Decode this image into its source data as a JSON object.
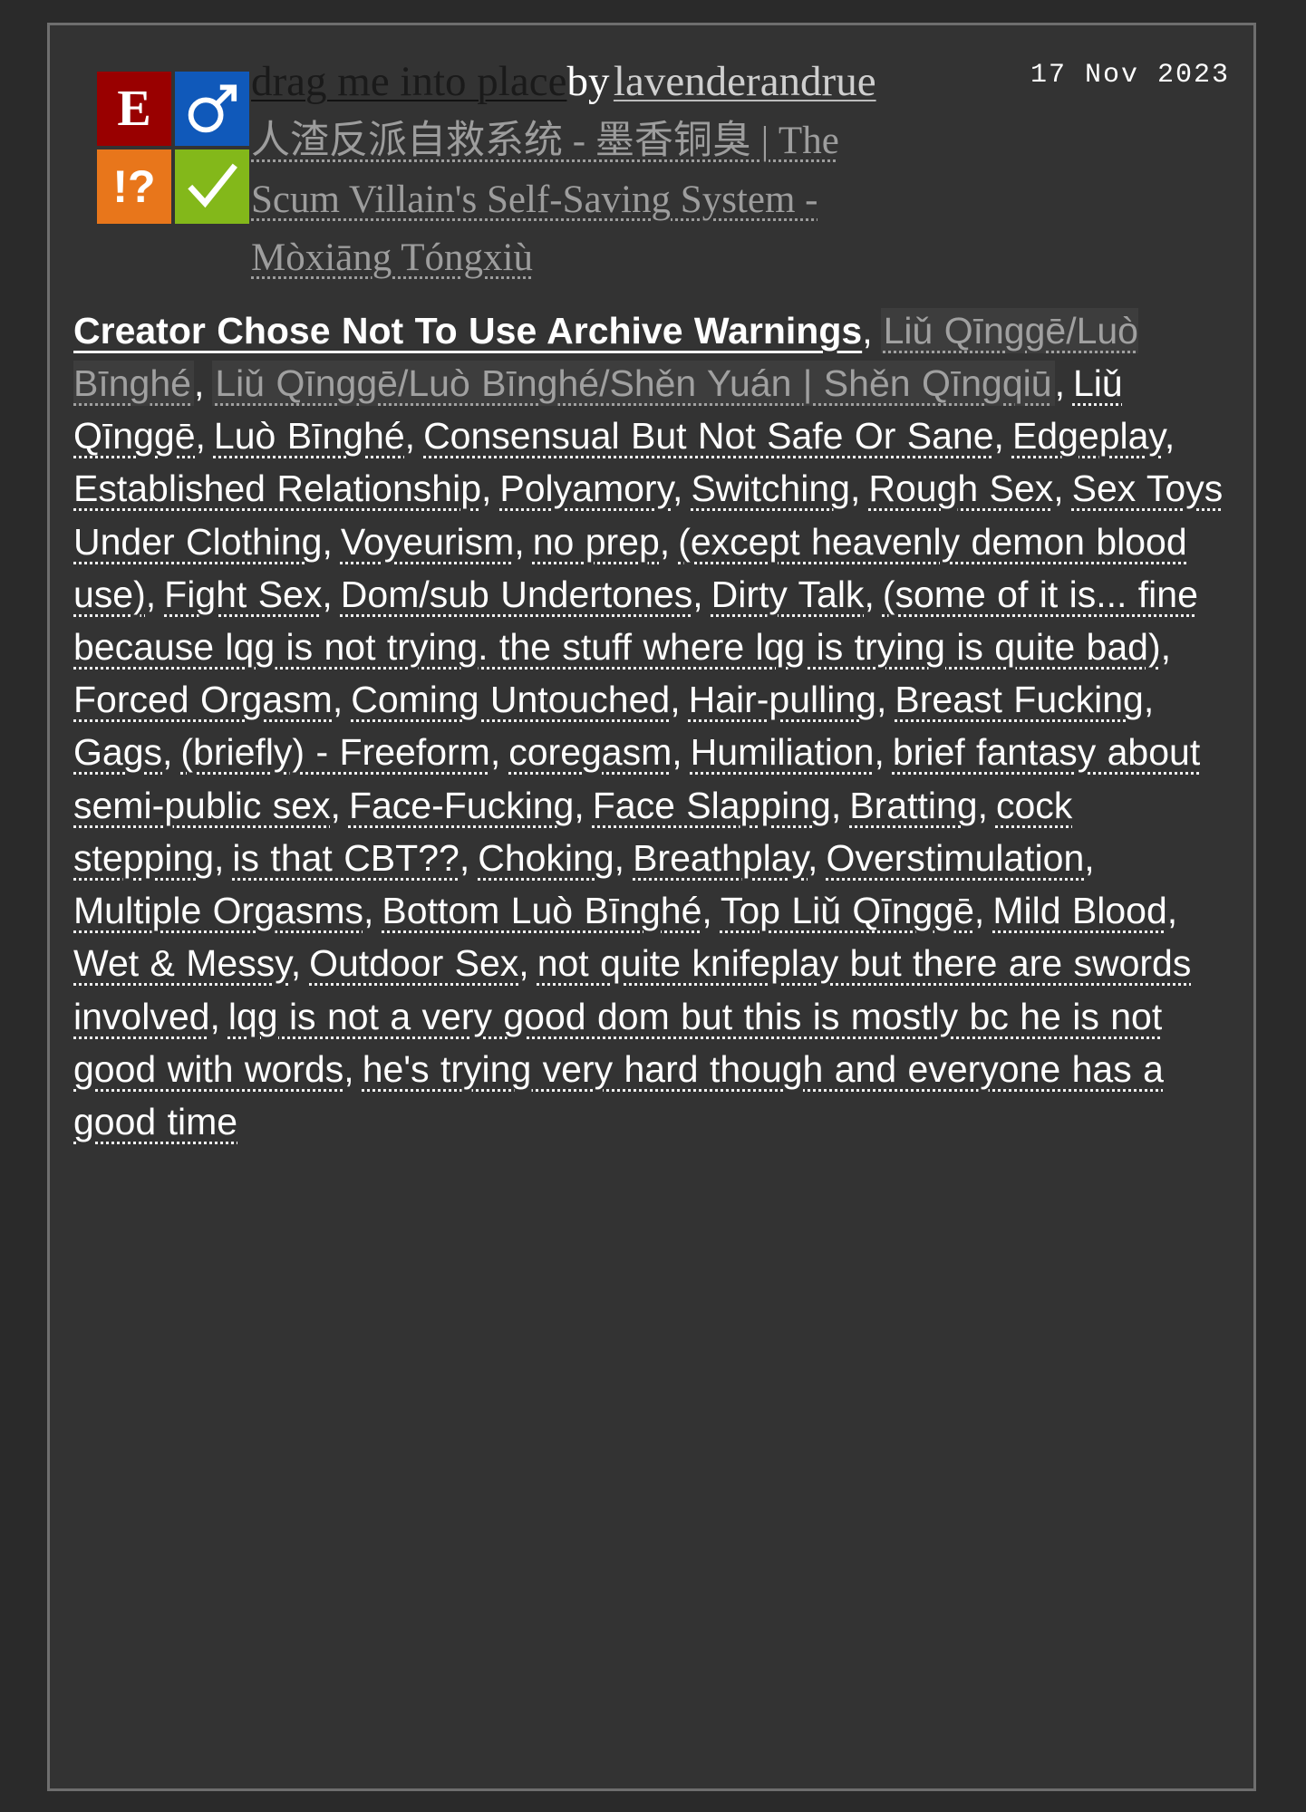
{
  "required_tags": [
    {
      "name": "rating-explicit",
      "glyph": "E",
      "label": "Explicit",
      "color": "#990000"
    },
    {
      "name": "category-male-male",
      "glyph": "♂",
      "label": "M/M",
      "color": "#1059ba"
    },
    {
      "name": "warning-choosenotto",
      "glyph": "!?",
      "label": "Choose Not To Use Archive Warnings",
      "color": "#e8761b"
    },
    {
      "name": "complete-yes",
      "glyph": "✓",
      "label": "Complete Work",
      "color": "#83b81a"
    }
  ],
  "header": {
    "title": "drag me into place",
    "by": "by",
    "author": "lavenderandrue",
    "date": "17 Nov 2023"
  },
  "fandoms": [
    "人渣反派自救系统 - 墨香铜臭 | The Scum Villain's Self-Saving System - Mòxiāng Tóngxiù"
  ],
  "tags": [
    {
      "text": "Creator Chose Not To Use Archive Warnings",
      "type": "warning"
    },
    {
      "text": "Liǔ Qīnggē/Luò Bīnghé",
      "type": "relationship"
    },
    {
      "text": "Liǔ Qīnggē/Luò Bīnghé/Shěn Yuán | Shěn Qīngqiū",
      "type": "relationship"
    },
    {
      "text": "Liǔ Qīnggē",
      "type": "character"
    },
    {
      "text": "Luò Bīnghé",
      "type": "character"
    },
    {
      "text": "Consensual But Not Safe Or Sane",
      "type": "freeform"
    },
    {
      "text": "Edgeplay",
      "type": "freeform"
    },
    {
      "text": "Established Relationship",
      "type": "freeform"
    },
    {
      "text": "Polyamory",
      "type": "freeform"
    },
    {
      "text": "Switching",
      "type": "freeform"
    },
    {
      "text": "Rough Sex",
      "type": "freeform"
    },
    {
      "text": "Sex Toys Under Clothing",
      "type": "freeform"
    },
    {
      "text": "Voyeurism",
      "type": "freeform"
    },
    {
      "text": "no prep",
      "type": "freeform"
    },
    {
      "text": "(except heavenly demon blood use)",
      "type": "freeform"
    },
    {
      "text": "Fight Sex",
      "type": "freeform"
    },
    {
      "text": "Dom/sub Undertones",
      "type": "freeform"
    },
    {
      "text": "Dirty Talk",
      "type": "freeform"
    },
    {
      "text": "(some of it is... fine because lqg is not trying. the stuff where lqg is trying is quite bad)",
      "type": "freeform"
    },
    {
      "text": "Forced Orgasm",
      "type": "freeform"
    },
    {
      "text": "Coming Untouched",
      "type": "freeform"
    },
    {
      "text": "Hair-pulling",
      "type": "freeform"
    },
    {
      "text": "Breast Fucking",
      "type": "freeform"
    },
    {
      "text": "Gags",
      "type": "freeform"
    },
    {
      "text": "(briefly) - Freeform",
      "type": "freeform"
    },
    {
      "text": "coregasm",
      "type": "freeform"
    },
    {
      "text": "Humiliation",
      "type": "freeform"
    },
    {
      "text": "brief fantasy about semi-public sex",
      "type": "freeform"
    },
    {
      "text": "Face-Fucking",
      "type": "freeform"
    },
    {
      "text": "Face Slapping",
      "type": "freeform"
    },
    {
      "text": "Bratting",
      "type": "freeform"
    },
    {
      "text": "cock stepping",
      "type": "freeform"
    },
    {
      "text": "is that CBT??",
      "type": "freeform"
    },
    {
      "text": "Choking",
      "type": "freeform"
    },
    {
      "text": "Breathplay",
      "type": "freeform"
    },
    {
      "text": "Overstimulation",
      "type": "freeform"
    },
    {
      "text": "Multiple Orgasms",
      "type": "freeform"
    },
    {
      "text": "Bottom Luò Bīnghé",
      "type": "freeform"
    },
    {
      "text": "Top Liǔ Qīnggē",
      "type": "freeform"
    },
    {
      "text": "Mild Blood",
      "type": "freeform"
    },
    {
      "text": "Wet & Messy",
      "type": "freeform"
    },
    {
      "text": "Outdoor Sex",
      "type": "freeform"
    },
    {
      "text": "not quite knifeplay but there are swords involved",
      "type": "freeform"
    },
    {
      "text": "lqg is not a very good dom but this is mostly bc he is not good with words",
      "type": "freeform"
    },
    {
      "text": "he's trying very hard though and everyone has a good time",
      "type": "freeform"
    }
  ],
  "colors": {
    "page_bg": "#2a2a2a",
    "panel_bg": "#333333",
    "panel_border": "#6e6e6e",
    "tag_text": "#ffffff",
    "dim_tag_text": "#a0a0a0",
    "dim_tag_bg": "#3d3d3d",
    "fandom_text": "#9d9d9d",
    "title_text": "#1a1a1a"
  }
}
